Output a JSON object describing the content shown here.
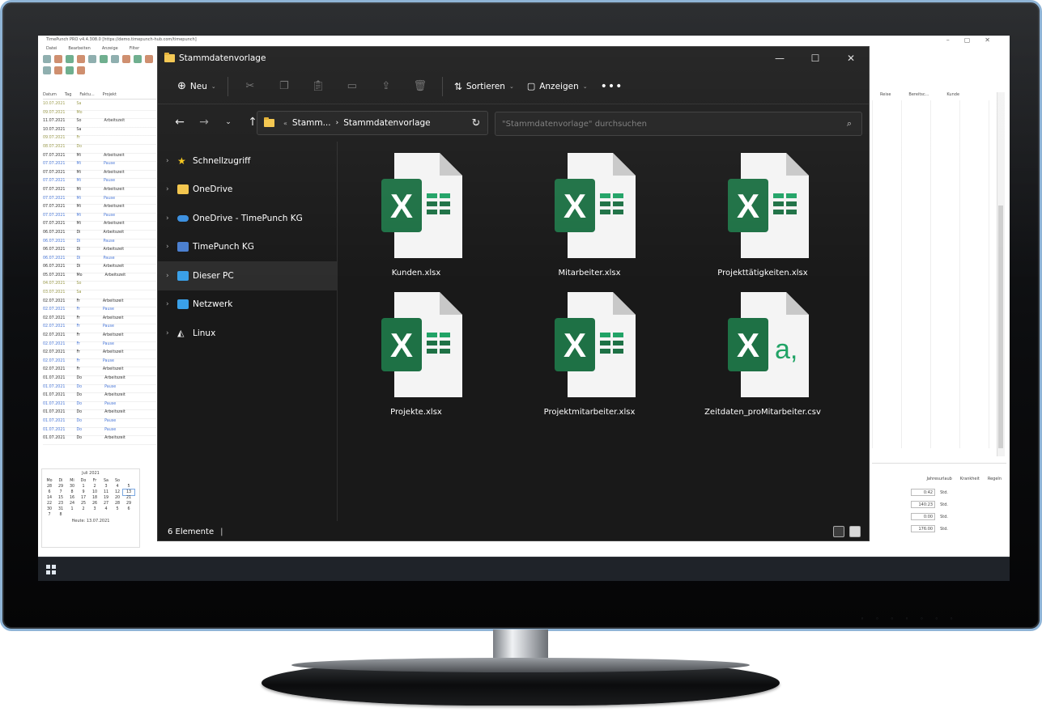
{
  "background_app": {
    "title": "TimePunch PRO v4.4.308.0 [https://demo.timepunch-hub.com/timepunch]",
    "menu": [
      "Datei",
      "Bearbeiten",
      "Anzeige",
      "Filter"
    ],
    "table_headers": [
      "Datum",
      "Tag",
      "Faktu...",
      "Projekt"
    ],
    "right_headers": [
      "Reise",
      "Bereitsc...",
      "Kunde"
    ],
    "rows": [
      {
        "date": "10.07.2021",
        "day": "Sa",
        "proj": "",
        "cls": "g"
      },
      {
        "date": "09.07.2021",
        "day": "Mo",
        "proj": "",
        "cls": "g"
      },
      {
        "date": "11.07.2021",
        "day": "So",
        "proj": "Arbeitszeit",
        "cls": ""
      },
      {
        "date": "10.07.2021",
        "day": "Sa",
        "proj": "",
        "cls": ""
      },
      {
        "date": "09.07.2021",
        "day": "Fr",
        "proj": "",
        "cls": "g"
      },
      {
        "date": "08.07.2021",
        "day": "Do",
        "proj": "",
        "cls": "g"
      },
      {
        "date": "07.07.2021",
        "day": "Mi",
        "proj": "Arbeitszeit",
        "cls": ""
      },
      {
        "date": "07.07.2021",
        "day": "Mi",
        "proj": "Pause",
        "cls": "b"
      },
      {
        "date": "07.07.2021",
        "day": "Mi",
        "proj": "Arbeitszeit",
        "cls": ""
      },
      {
        "date": "07.07.2021",
        "day": "Mi",
        "proj": "Pause",
        "cls": "b"
      },
      {
        "date": "07.07.2021",
        "day": "Mi",
        "proj": "Arbeitszeit",
        "cls": ""
      },
      {
        "date": "07.07.2021",
        "day": "Mi",
        "proj": "Pause",
        "cls": "b"
      },
      {
        "date": "07.07.2021",
        "day": "Mi",
        "proj": "Arbeitszeit",
        "cls": ""
      },
      {
        "date": "07.07.2021",
        "day": "Mi",
        "proj": "Pause",
        "cls": "b"
      },
      {
        "date": "07.07.2021",
        "day": "Mi",
        "proj": "Arbeitszeit",
        "cls": ""
      },
      {
        "date": "06.07.2021",
        "day": "Di",
        "proj": "Arbeitszeit",
        "cls": ""
      },
      {
        "date": "06.07.2021",
        "day": "Di",
        "proj": "Pause",
        "cls": "b"
      },
      {
        "date": "06.07.2021",
        "day": "Di",
        "proj": "Arbeitszeit",
        "cls": ""
      },
      {
        "date": "06.07.2021",
        "day": "Di",
        "proj": "Pause",
        "cls": "b"
      },
      {
        "date": "06.07.2021",
        "day": "Di",
        "proj": "Arbeitszeit",
        "cls": ""
      },
      {
        "date": "05.07.2021",
        "day": "Mo",
        "proj": "Arbeitszeit",
        "cls": ""
      },
      {
        "date": "04.07.2021",
        "day": "So",
        "proj": "",
        "cls": "g"
      },
      {
        "date": "03.07.2021",
        "day": "Sa",
        "proj": "",
        "cls": "g"
      },
      {
        "date": "02.07.2021",
        "day": "Fr",
        "proj": "Arbeitszeit",
        "cls": ""
      },
      {
        "date": "02.07.2021",
        "day": "Fr",
        "proj": "Pause",
        "cls": "b"
      },
      {
        "date": "02.07.2021",
        "day": "Fr",
        "proj": "Arbeitszeit",
        "cls": ""
      },
      {
        "date": "02.07.2021",
        "day": "Fr",
        "proj": "Pause",
        "cls": "b"
      },
      {
        "date": "02.07.2021",
        "day": "Fr",
        "proj": "Arbeitszeit",
        "cls": ""
      },
      {
        "date": "02.07.2021",
        "day": "Fr",
        "proj": "Pause",
        "cls": "b"
      },
      {
        "date": "02.07.2021",
        "day": "Fr",
        "proj": "Arbeitszeit",
        "cls": ""
      },
      {
        "date": "02.07.2021",
        "day": "Fr",
        "proj": "Pause",
        "cls": "b"
      },
      {
        "date": "02.07.2021",
        "day": "Fr",
        "proj": "Arbeitszeit",
        "cls": ""
      },
      {
        "date": "01.07.2021",
        "day": "Do",
        "proj": "Arbeitszeit",
        "cls": ""
      },
      {
        "date": "01.07.2021",
        "day": "Do",
        "proj": "Pause",
        "cls": "b"
      },
      {
        "date": "01.07.2021",
        "day": "Do",
        "proj": "Arbeitszeit",
        "cls": ""
      },
      {
        "date": "01.07.2021",
        "day": "Do",
        "proj": "Pause",
        "cls": "b"
      },
      {
        "date": "01.07.2021",
        "day": "Do",
        "proj": "Arbeitszeit",
        "cls": ""
      },
      {
        "date": "01.07.2021",
        "day": "Do",
        "proj": "Pause",
        "cls": "b"
      },
      {
        "date": "01.07.2021",
        "day": "Do",
        "proj": "Pause",
        "cls": "b"
      },
      {
        "date": "01.07.2021",
        "day": "Do",
        "proj": "Arbeitszeit",
        "cls": ""
      }
    ],
    "calendar": {
      "month": "Juli 2021",
      "weekdays": [
        "Mo",
        "Di",
        "Mi",
        "Do",
        "Fr",
        "Sa",
        "So"
      ],
      "days": [
        "28",
        "29",
        "30",
        "1",
        "2",
        "3",
        "4",
        "5",
        "6",
        "7",
        "8",
        "9",
        "10",
        "11",
        "12",
        "13",
        "14",
        "15",
        "16",
        "17",
        "18",
        "19",
        "20",
        "21",
        "22",
        "23",
        "24",
        "25",
        "26",
        "27",
        "28",
        "29",
        "30",
        "31",
        "1",
        "2",
        "3",
        "4",
        "5",
        "6",
        "7",
        "8"
      ],
      "today": "Heute: 13.07.2021"
    },
    "stats_headers": [
      "Jahresurlaub",
      "Krankheit",
      "Regeln"
    ],
    "stats": [
      {
        "value": "0:42",
        "unit": "Std."
      },
      {
        "value": "140:23",
        "unit": "Std."
      },
      {
        "value": "0:00",
        "unit": "Std."
      },
      {
        "value": "176:00",
        "unit": "Std."
      }
    ]
  },
  "explorer": {
    "title": "Stammdatenvorlage",
    "toolbar": {
      "new_label": "Neu",
      "sort_label": "Sortieren",
      "view_label": "Anzeigen"
    },
    "breadcrumb": [
      "Stamm...",
      "Stammdatenvorlage"
    ],
    "search_placeholder": "\"Stammdatenvorlage\" durchsuchen",
    "sidebar": [
      {
        "label": "Schnellzugriff",
        "icon": "star-icon",
        "color": "#f5c518"
      },
      {
        "label": "OneDrive",
        "icon": "folder-icon",
        "color": "#f3c54a"
      },
      {
        "label": "OneDrive - TimePunch KG",
        "icon": "cloud-icon",
        "color": "#3a8fe0"
      },
      {
        "label": "TimePunch KG",
        "icon": "building-icon",
        "color": "#4a7fd0"
      },
      {
        "label": "Dieser PC",
        "icon": "monitor-icon",
        "color": "#3aa0e8"
      },
      {
        "label": "Netzwerk",
        "icon": "network-icon",
        "color": "#3aa0e8"
      },
      {
        "label": "Linux",
        "icon": "penguin-icon",
        "color": "#e8e8e8"
      }
    ],
    "files": [
      {
        "name": "Kunden.xlsx",
        "type": "xlsx"
      },
      {
        "name": "Mitarbeiter.xlsx",
        "type": "xlsx"
      },
      {
        "name": "Projekttätigkeiten.xlsx",
        "type": "xlsx"
      },
      {
        "name": "Projekte.xlsx",
        "type": "xlsx"
      },
      {
        "name": "Projektmitarbeiter.xlsx",
        "type": "xlsx"
      },
      {
        "name": "Zeitdaten_proMitarbeiter.csv",
        "type": "csv"
      }
    ],
    "status_count": "6 Elemente",
    "colors": {
      "background": "#191919",
      "excel_green": "#1e7145",
      "excel_light": "#21a366"
    }
  }
}
